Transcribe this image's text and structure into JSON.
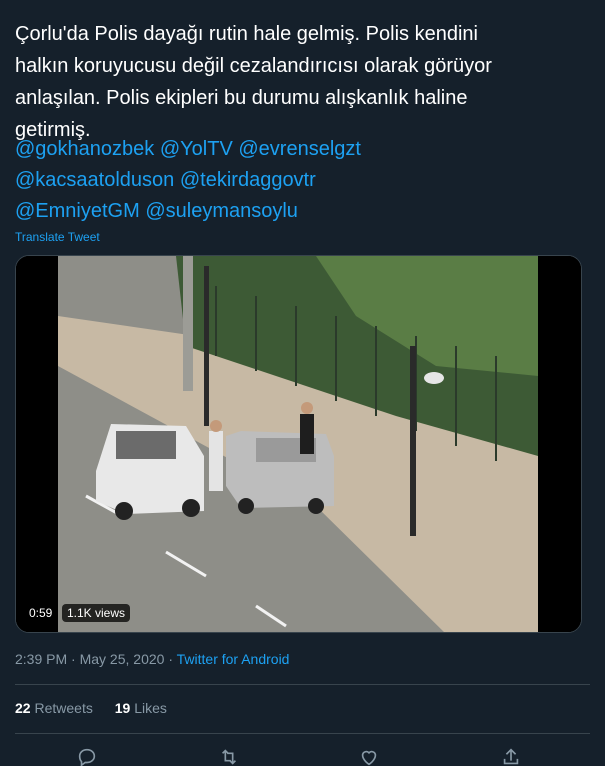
{
  "tweet": {
    "text_lines": [
      "Çorlu'da Polis dayağı rutin hale gelmiş. Polis kendini",
      "halkın koruyucusu değil cezalandırıcısı olarak görüyor",
      "anlaşılan. Polis ekipleri bu durumu alışkanlık haline",
      "getirmiş."
    ],
    "mentions": [
      [
        "@gokhanozbek",
        "@YolTV",
        "@evrenselgzt"
      ],
      [
        "@kacsaatolduson",
        "@tekirdaggovtr"
      ],
      [
        "@EmniyetGM",
        "@suleymansoylu"
      ]
    ],
    "translate_label": "Translate Tweet"
  },
  "video": {
    "duration": "0:59",
    "views": "1.1K views"
  },
  "meta": {
    "time": "2:39 PM",
    "separator1": " · ",
    "date": "May 25, 2020",
    "separator2": " · ",
    "source": "Twitter for Android"
  },
  "stats": {
    "retweets_count": "22",
    "retweets_label": "Retweets",
    "likes_count": "19",
    "likes_label": "Likes"
  },
  "actions": [
    "reply-icon",
    "retweet-icon",
    "like-icon",
    "share-icon"
  ],
  "colors": {
    "background": "#15202b",
    "accent": "#1da1f2",
    "muted": "#8899a6",
    "border": "#38444d"
  }
}
